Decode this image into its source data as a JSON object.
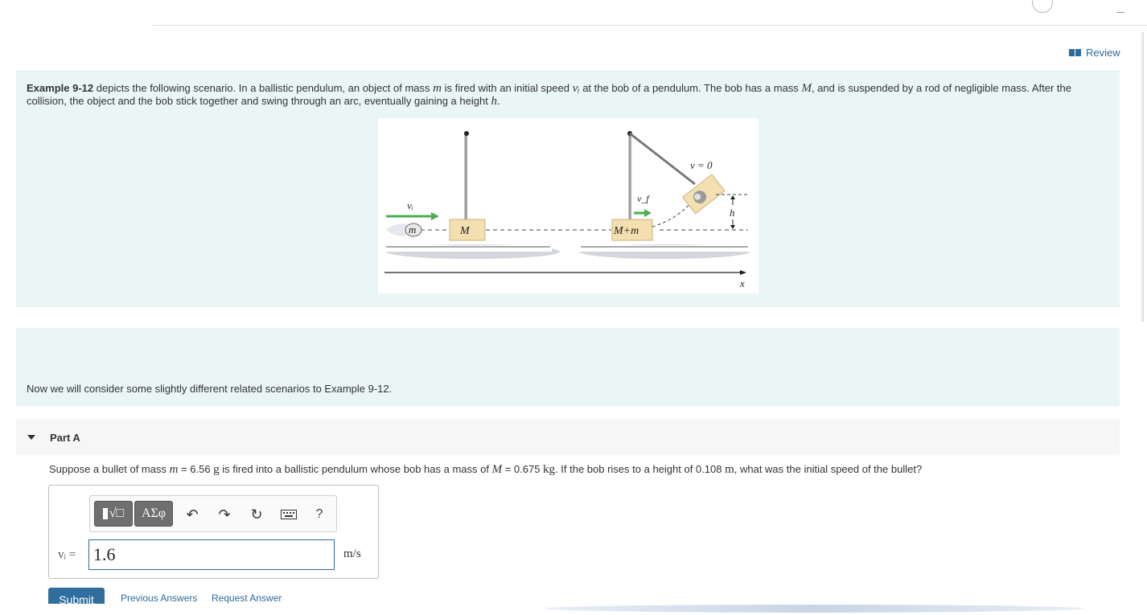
{
  "header": {
    "review_label": "Review"
  },
  "intro": {
    "example_ref": "Example 9-12",
    "text_1": " depicts the following scenario. In a ballistic pendulum, an object of mass ",
    "var_m": "m",
    "text_2": " is fired with an initial speed ",
    "var_vi": "vᵢ",
    "text_3": " at the bob of a pendulum. The bob has a mass ",
    "var_M": "M",
    "text_4": ", and is suspended by a rod of negligible mass. After the collision, the object and the bob stick together and swing through an arc, eventually gaining a height ",
    "var_h": "h",
    "text_5": "."
  },
  "figure": {
    "label_vi": "vᵢ",
    "label_m": "m",
    "label_M": "M",
    "label_vf": "v_f",
    "label_Mm": "M+m",
    "label_v0": "v = 0",
    "label_h": "h",
    "label_x": "x",
    "colors": {
      "arrow_green": "#4caf50",
      "block_fill": "#f3dfb0",
      "ground_gray": "#d3d6da"
    }
  },
  "related": {
    "text": "Now we will consider some slightly different related scenarios to Example 9-12."
  },
  "part_a": {
    "title": "Part A",
    "q_1": "Suppose a bullet of mass ",
    "q_m": "m",
    "q_2": " = 6.56 ",
    "q_unit_g": "g",
    "q_3": " is fired into a ballistic pendulum whose bob has a mass of ",
    "q_M": "M",
    "q_4": " = 0.675 ",
    "q_unit_kg": "kg",
    "q_5": ". If the bob rises to a height of 0.108 ",
    "q_unit_m": "m",
    "q_6": ", what was the initial speed of the bullet?"
  },
  "answer": {
    "toolbar": {
      "templates_label": "√□",
      "greek_label": "ΑΣφ",
      "undo_icon": "undo-icon",
      "redo_icon": "redo-icon",
      "reset_icon": "reset-icon",
      "keyboard_icon": "keyboard-icon",
      "help_label": "?"
    },
    "variable_label": "vᵢ =",
    "value": "1.6",
    "unit": "m/s"
  },
  "actions": {
    "submit_label": "Submit",
    "previous_answers_label": "Previous Answers",
    "request_answer_label": "Request Answer"
  }
}
